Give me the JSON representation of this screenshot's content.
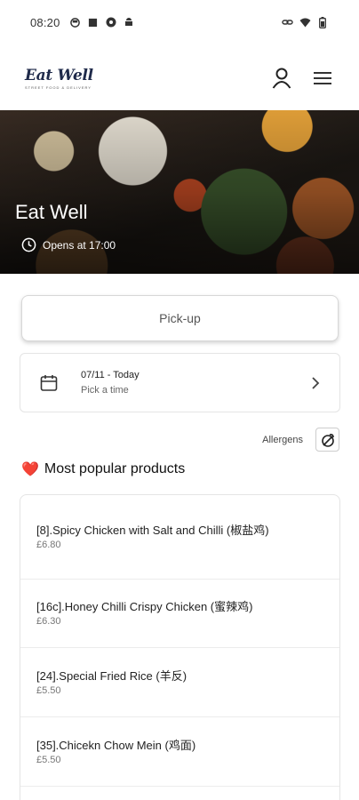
{
  "status_bar": {
    "time": "08:20"
  },
  "header": {
    "logo_text": "Eat Well",
    "logo_tagline": "STREET FOOD & DELIVERY"
  },
  "hero": {
    "title": "Eat Well",
    "hours": "Opens at 17:00"
  },
  "order": {
    "pickup_label": "Pick-up",
    "time_date": "07/11 - Today",
    "time_hint": "Pick a time"
  },
  "allergens": {
    "label": "Allergens"
  },
  "popular": {
    "heart": "❤️",
    "title": "Most popular products",
    "items": [
      {
        "name": "[8].Spicy Chicken with Salt and Chilli (椒盐鸡)",
        "price": "£6.80"
      },
      {
        "name": "[16c].Honey Chilli Crispy Chicken (蜜辣鸡)",
        "price": "£6.30"
      },
      {
        "name": "[24].Special Fried Rice (羊反)",
        "price": "£5.50"
      },
      {
        "name": "[35].Chicekn Chow Mein (鸡面)",
        "price": "£5.50"
      }
    ]
  },
  "colors": {
    "brand": "#1f2a4a",
    "heart": "#e0263a",
    "accent": "#e8a43a"
  }
}
